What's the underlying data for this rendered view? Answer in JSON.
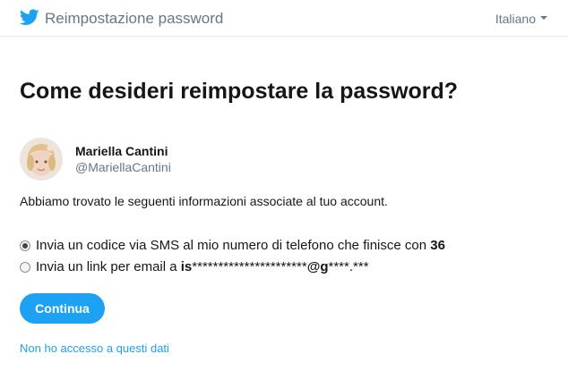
{
  "header": {
    "title": "Reimpostazione password",
    "language": "Italiano",
    "brand_color": "#1DA1F2"
  },
  "main": {
    "heading": "Come desideri reimpostare la password?",
    "account": {
      "name": "Mariella Cantini",
      "handle": "@MariellaCantini"
    },
    "info_text": "Abbiamo trovato le seguenti informazioni associate al tuo account.",
    "options": [
      {
        "label": "Invia un codice via SMS al mio numero di telefono che finisce con ",
        "suffix": "36",
        "checked": true
      },
      {
        "label": "Invia un link per email a ",
        "email_start": "is",
        "email_mask1": "**********************",
        "email_domain": "@g",
        "email_mask2": "****.***",
        "checked": false
      }
    ],
    "continue_label": "Continua",
    "no_access_link": "Non ho accesso a questi dati"
  }
}
